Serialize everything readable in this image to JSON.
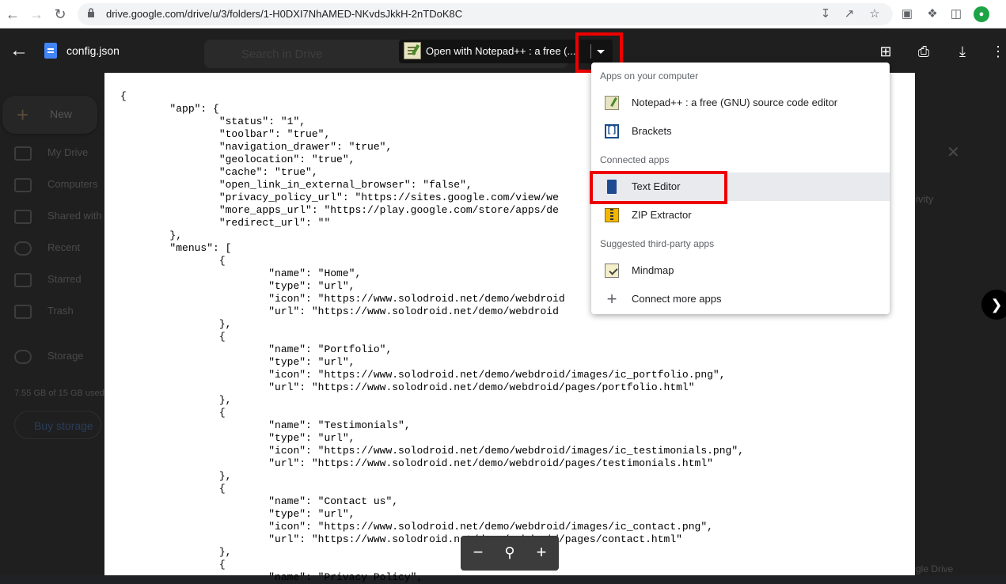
{
  "browser": {
    "url": "drive.google.com/drive/u/3/folders/1-H0DXI7NhAMED-NKvdsJkkH-2nTDoK8C"
  },
  "drive": {
    "search_placeholder": "Search in Drive",
    "new_label": "New",
    "sidebar": [
      "My Drive",
      "Computers",
      "Shared with me",
      "Recent",
      "Starred",
      "Trash",
      "Storage"
    ],
    "storage_text": "7.55 GB of 15 GB used",
    "buy_storage": "Buy storage",
    "right_fragment": "ivity",
    "bottom_right_fragment": "gle Drive"
  },
  "viewer": {
    "file_name": "config.json",
    "open_with_label": "Open with Notepad++ : a free (..."
  },
  "menu": {
    "section_computer": "Apps on your computer",
    "section_connected": "Connected apps",
    "section_suggested": "Suggested third-party apps",
    "items": [
      {
        "label": "Notepad++ : a free (GNU) source code editor",
        "icon": "notepad-icon"
      },
      {
        "label": "Brackets",
        "icon": "brackets-icon"
      },
      {
        "label": "Text Editor",
        "icon": "text-editor-icon"
      },
      {
        "label": "ZIP Extractor",
        "icon": "zip-extractor-icon"
      },
      {
        "label": "Mindmap",
        "icon": "mindmap-icon"
      },
      {
        "label": "Connect more apps",
        "icon": "plus-icon"
      }
    ]
  },
  "document": {
    "content": "{\n\t\"app\": {\n\t\t\"status\": \"1\",\n\t\t\"toolbar\": \"true\",\n\t\t\"navigation_drawer\": \"true\",\n\t\t\"geolocation\": \"true\",\n\t\t\"cache\": \"true\",\n\t\t\"open_link_in_external_browser\": \"false\",\n\t\t\"privacy_policy_url\": \"https://sites.google.com/view/we\n\t\t\"more_apps_url\": \"https://play.google.com/store/apps/de\n\t\t\"redirect_url\": \"\"\n\t},\n\t\"menus\": [\n\t\t{\n\t\t\t\"name\": \"Home\",\n\t\t\t\"type\": \"url\",\n\t\t\t\"icon\": \"https://www.solodroid.net/demo/webdroid\n\t\t\t\"url\": \"https://www.solodroid.net/demo/webdroid\n\t\t},\n\t\t{\n\t\t\t\"name\": \"Portfolio\",\n\t\t\t\"type\": \"url\",\n\t\t\t\"icon\": \"https://www.solodroid.net/demo/webdroid/images/ic_portfolio.png\",\n\t\t\t\"url\": \"https://www.solodroid.net/demo/webdroid/pages/portfolio.html\"\n\t\t},\n\t\t{\n\t\t\t\"name\": \"Testimonials\",\n\t\t\t\"type\": \"url\",\n\t\t\t\"icon\": \"https://www.solodroid.net/demo/webdroid/images/ic_testimonials.png\",\n\t\t\t\"url\": \"https://www.solodroid.net/demo/webdroid/pages/testimonials.html\"\n\t\t},\n\t\t{\n\t\t\t\"name\": \"Contact us\",\n\t\t\t\"type\": \"url\",\n\t\t\t\"icon\": \"https://www.solodroid.net/demo/webdroid/images/ic_contact.png\",\n\t\t\t\"url\": \"https://www.solodroid.net/demo/webdroid/pages/contact.html\"\n\t\t},\n\t\t{\n\t\t\t\"name\": \"Privacy Policy\","
  },
  "colors": {
    "highlight": "#ee0000",
    "overlay": "#202124",
    "menu_hover": "#e8eaed"
  }
}
